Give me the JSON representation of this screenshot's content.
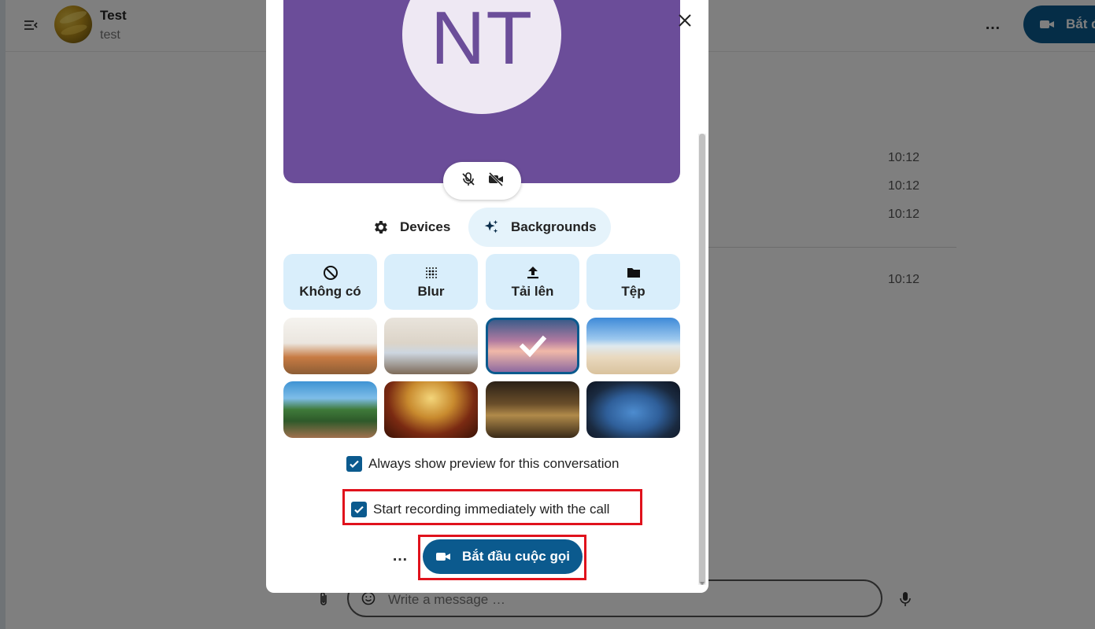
{
  "conversation": {
    "title": "Test",
    "subtitle": "test",
    "call_button_label": "Bắt đ",
    "more_label": "…"
  },
  "messages": [
    {
      "time": "10:12"
    },
    {
      "time": "10:12"
    },
    {
      "time": "10:12"
    },
    {
      "time": "10:12"
    }
  ],
  "composer": {
    "placeholder": "Write a message …"
  },
  "dialog": {
    "avatar_initials": "NT",
    "tabs": [
      {
        "label": "Devices",
        "icon": "gear-icon"
      },
      {
        "label": "Backgrounds",
        "icon": "sparkle-icon",
        "active": true
      }
    ],
    "background_options": [
      {
        "label": "Không có",
        "icon": "no-entry-icon"
      },
      {
        "label": "Blur",
        "icon": "blur-icon"
      },
      {
        "label": "Tải lên",
        "icon": "upload-icon"
      },
      {
        "label": "Tệp",
        "icon": "folder-icon"
      }
    ],
    "thumbnails": [
      {
        "name": "living-room"
      },
      {
        "name": "sofa-room"
      },
      {
        "name": "pink-gradient",
        "selected": true
      },
      {
        "name": "beach"
      },
      {
        "name": "garden-bridge"
      },
      {
        "name": "theater"
      },
      {
        "name": "library"
      },
      {
        "name": "space-station"
      }
    ],
    "checkboxes": [
      {
        "label": "Always show preview for this conversation",
        "checked": true
      },
      {
        "label": "Start recording immediately with the call",
        "checked": true
      }
    ],
    "more_label": "…",
    "start_call_label": "Bắt đầu cuộc gọi"
  },
  "colors": {
    "accent": "#0b5a8e",
    "avatar_bg": "#6b4d99",
    "highlight": "#e0121c",
    "option_bg": "#d9eefb"
  }
}
